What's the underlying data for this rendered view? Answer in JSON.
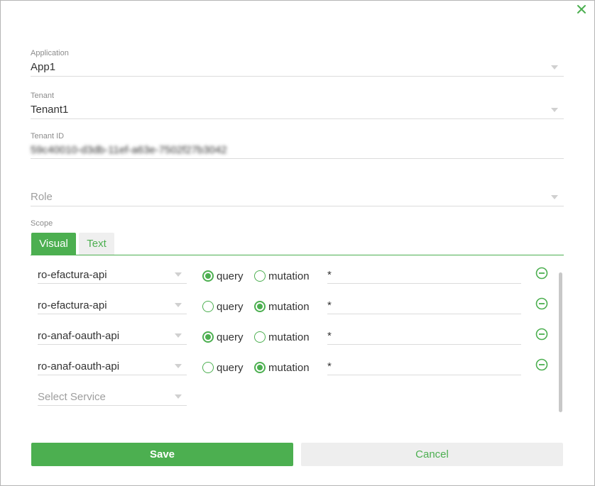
{
  "dialog": {
    "application": {
      "label": "Application",
      "value": "App1"
    },
    "tenant": {
      "label": "Tenant",
      "value": "Tenant1"
    },
    "tenant_id": {
      "label": "Tenant ID",
      "value": "59c40010-d3db-11ef-a63e-7502f27b3042"
    },
    "role": {
      "placeholder": "Role"
    },
    "scope": {
      "label": "Scope",
      "tabs": [
        {
          "label": "Visual",
          "active": true
        },
        {
          "label": "Text",
          "active": false
        }
      ],
      "rows": [
        {
          "service": "ro-efactura-api",
          "query_label": "query",
          "mutation_label": "mutation",
          "selected": "query",
          "field": "*"
        },
        {
          "service": "ro-efactura-api",
          "query_label": "query",
          "mutation_label": "mutation",
          "selected": "mutation",
          "field": "*"
        },
        {
          "service": "ro-anaf-oauth-api",
          "query_label": "query",
          "mutation_label": "mutation",
          "selected": "query",
          "field": "*"
        },
        {
          "service": "ro-anaf-oauth-api",
          "query_label": "query",
          "mutation_label": "mutation",
          "selected": "mutation",
          "field": "*"
        }
      ],
      "new_service_placeholder": "Select Service"
    },
    "buttons": {
      "save": "Save",
      "cancel": "Cancel"
    }
  },
  "colors": {
    "accent": "#4caf50",
    "border": "#dcdcdc",
    "label": "#8c8c8c"
  },
  "icons": {
    "close": "close-icon",
    "remove": "minus-circle-icon",
    "dropdown": "chevron-down-icon"
  }
}
